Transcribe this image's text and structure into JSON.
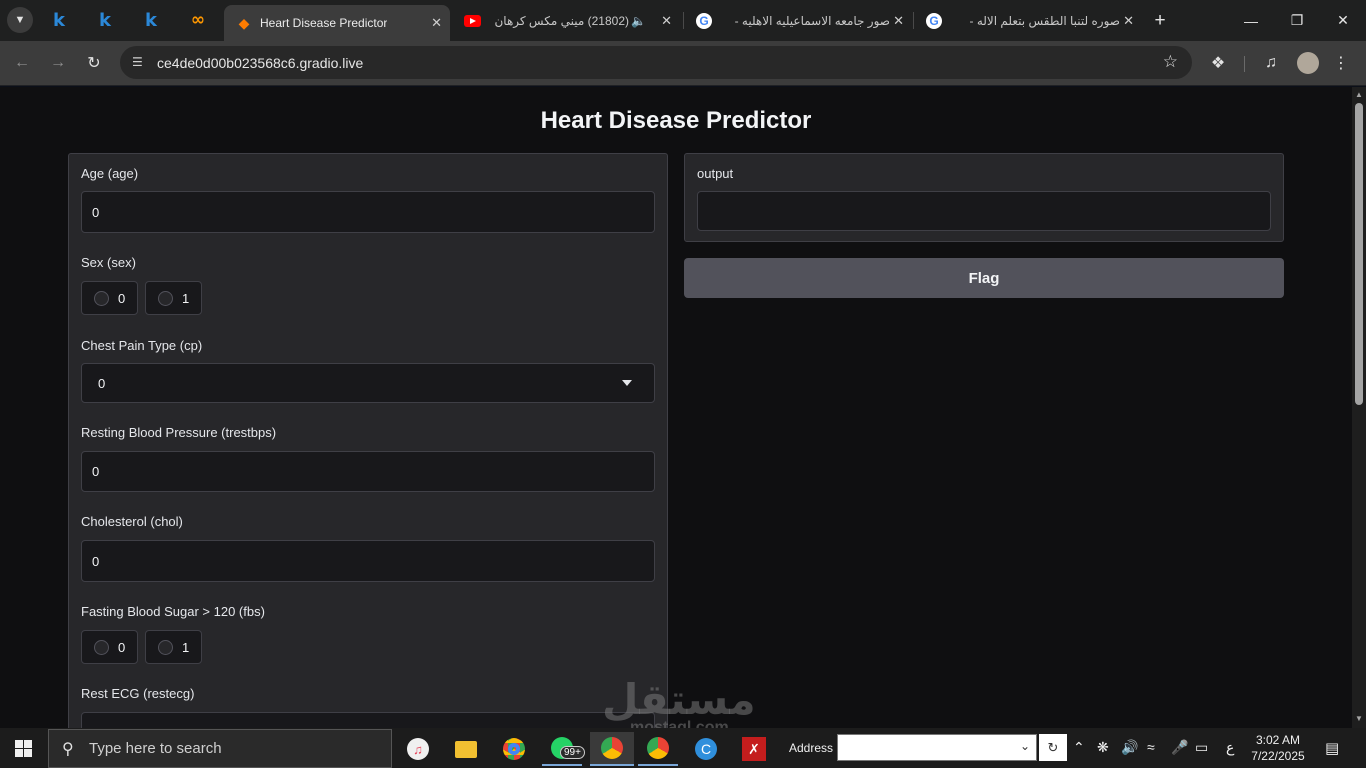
{
  "browser": {
    "tabs": [
      {
        "title": "Heart Disease Predictor",
        "active": true
      },
      {
        "title": "(21802) ميني مكس كرهان",
        "active": false
      },
      {
        "title": "صور جامعه الاسماعيليه الاهليه -",
        "active": false
      },
      {
        "title": "صوره لتنبا الطقس بتعلم الاله -",
        "active": false
      }
    ],
    "pinned_tabs": [
      "k",
      "k",
      "k"
    ],
    "url": "ce4de0d00b023568c6.gradio.live",
    "icons": {
      "tab_search": "chevron-down-icon",
      "new_tab": "plus-icon",
      "close": "close-icon",
      "back": "arrow-left-icon",
      "forward": "arrow-right-icon",
      "reload": "reload-icon",
      "bookmark": "star-icon",
      "extensions": "puzzle-icon",
      "media": "playlist-icon",
      "menu": "kebab-icon"
    }
  },
  "app": {
    "title": "Heart Disease Predictor",
    "inputs": {
      "age": {
        "label": "Age (age)",
        "value": "0"
      },
      "sex": {
        "label": "Sex (sex)",
        "options": [
          "0",
          "1"
        ]
      },
      "cp": {
        "label": "Chest Pain Type (cp)",
        "value": "0"
      },
      "trestbps": {
        "label": "Resting Blood Pressure (trestbps)",
        "value": "0"
      },
      "chol": {
        "label": "Cholesterol (chol)",
        "value": "0"
      },
      "fbs": {
        "label": "Fasting Blood Sugar > 120 (fbs)",
        "options": [
          "0",
          "1"
        ]
      },
      "restecg": {
        "label": "Rest ECG (restecg)"
      }
    },
    "output": {
      "label": "output",
      "value": ""
    },
    "flag_label": "Flag"
  },
  "watermark": {
    "text": "مستقل",
    "sub": "mostaql.com"
  },
  "taskbar": {
    "search_placeholder": "Type here to search",
    "address_label": "Address",
    "whatsapp_badge": "99+",
    "time": "3:02 AM",
    "date": "7/22/2025",
    "lang": "ع"
  },
  "colors": {
    "page_bg": "#0f0f11",
    "panel_bg": "#27272a",
    "input_bg": "#18181b",
    "flag_button": "#52525b",
    "chrome_tabbar": "#1f2020",
    "chrome_toolbar": "#3c3c3c"
  }
}
